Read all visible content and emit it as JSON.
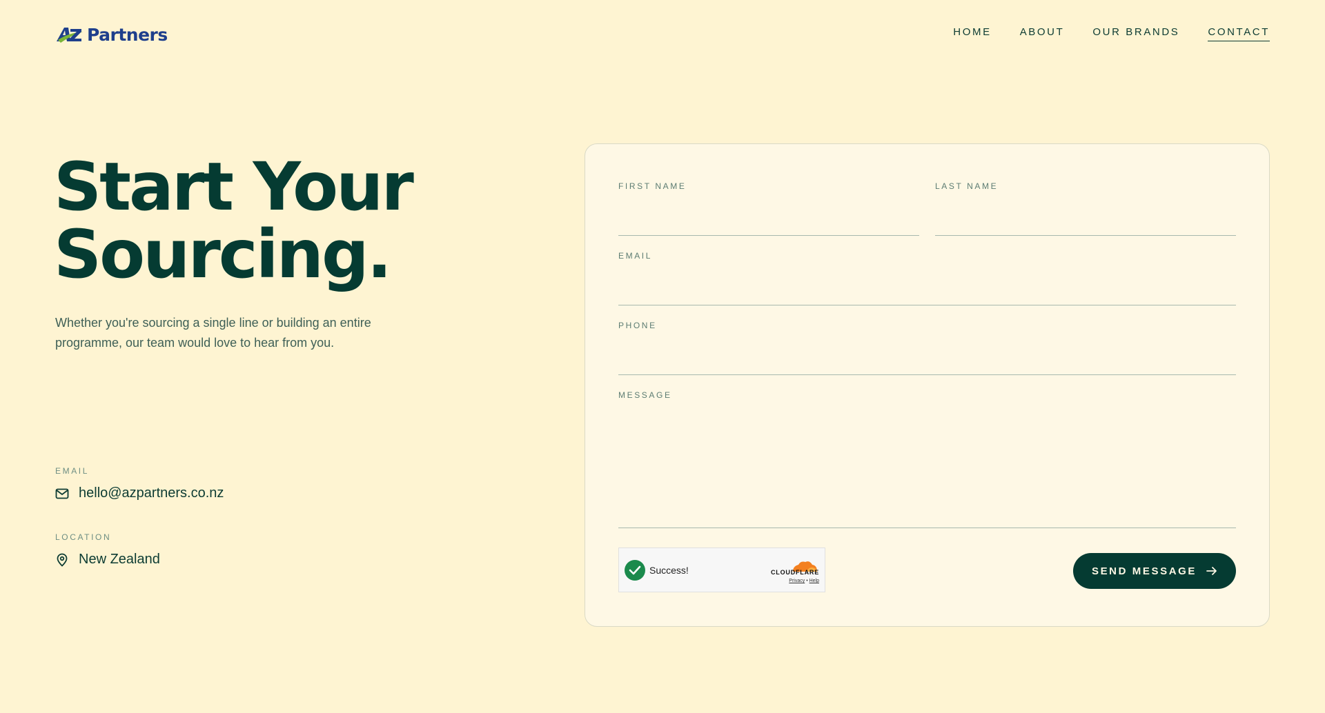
{
  "brand": {
    "logo_text": "Partners",
    "logo_mark": "AZ"
  },
  "nav": {
    "items": [
      {
        "label": "HOME"
      },
      {
        "label": "ABOUT"
      },
      {
        "label": "OUR BRANDS"
      },
      {
        "label": "CONTACT",
        "active": true
      }
    ]
  },
  "hero": {
    "title_line1": "Start Your",
    "title_line2": "Sourcing.",
    "subtitle": "Whether you're sourcing a single line or building an entire programme, our team would love to hear from you."
  },
  "contact_info": {
    "email_label": "EMAIL",
    "email_value": "hello@azpartners.co.nz",
    "email_icon": "mail-icon",
    "location_label": "LOCATION",
    "location_value": "New Zealand",
    "location_icon": "map-pin-icon"
  },
  "form": {
    "first_name_label": "FIRST NAME",
    "first_name_value": "",
    "last_name_label": "LAST NAME",
    "last_name_value": "",
    "email_label": "EMAIL",
    "email_value": "",
    "phone_label": "PHONE",
    "phone_value": "",
    "message_label": "MESSAGE",
    "message_value": "",
    "captcha_status": "Success!",
    "captcha_brand": "CLOUDFLARE",
    "captcha_privacy": "Privacy",
    "captcha_sep": "•",
    "captcha_help": "Help",
    "submit_label": "SEND MESSAGE",
    "submit_icon": "arrow-right-icon"
  },
  "colors": {
    "background": "#fef4d2",
    "card": "#fef8e5",
    "primary": "#053b32",
    "logo_blue": "#1e3f8c",
    "logo_green": "#7bb53a",
    "success": "#1b8a4c",
    "cloudflare_orange": "#f38020"
  }
}
